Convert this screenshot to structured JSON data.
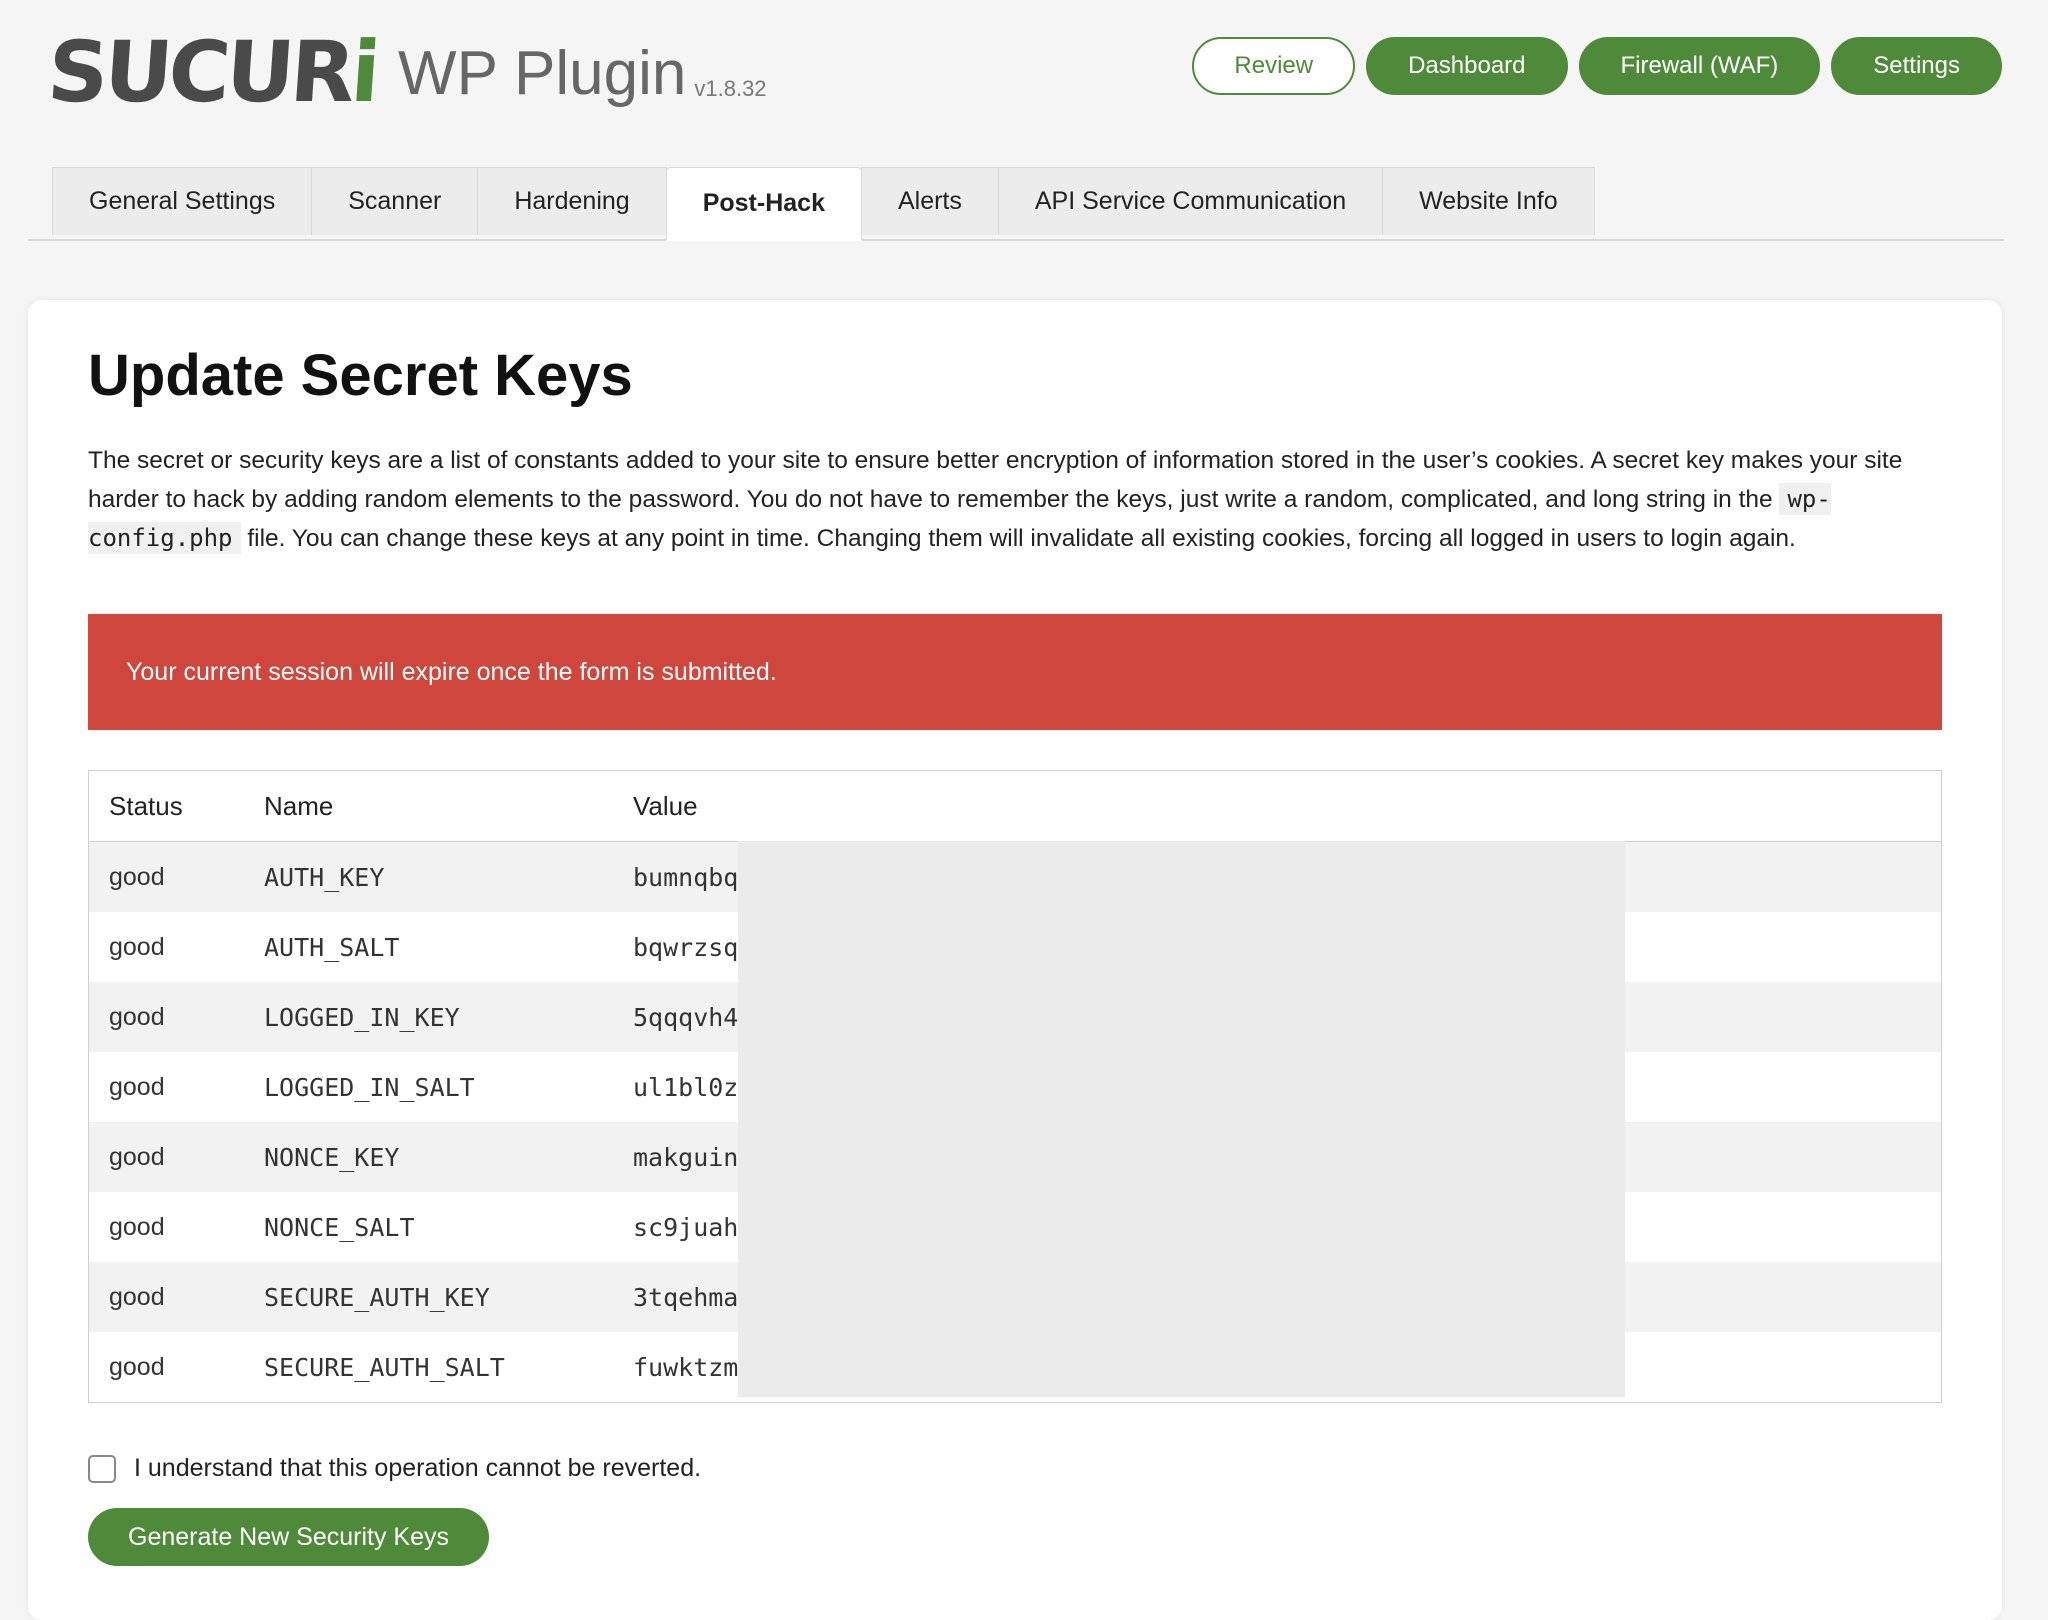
{
  "header": {
    "logo_text": "SUCURi",
    "product": "WP Plugin",
    "version": "v1.8.32",
    "buttons": [
      "Review",
      "Dashboard",
      "Firewall (WAF)",
      "Settings"
    ]
  },
  "tabs": [
    {
      "label": "General Settings",
      "active": false
    },
    {
      "label": "Scanner",
      "active": false
    },
    {
      "label": "Hardening",
      "active": false
    },
    {
      "label": "Post-Hack",
      "active": true
    },
    {
      "label": "Alerts",
      "active": false
    },
    {
      "label": "API Service Communication",
      "active": false
    },
    {
      "label": "Website Info",
      "active": false
    }
  ],
  "main": {
    "title": "Update Secret Keys",
    "desc_part1": "The secret or security keys are a list of constants added to your site to ensure better encryption of information stored in the user’s cookies. A secret key makes your site harder to hack by adding random elements to the password. You do not have to remember the keys, just write a random, complicated, and long string in the",
    "desc_code": "wp-config.php",
    "desc_part2": "file. You can change these keys at any point in time. Changing them will invalidate all existing cookies, forcing all logged in users to login again.",
    "alert": "Your current session will expire once the form is submitted.",
    "table": {
      "headers": [
        "Status",
        "Name",
        "Value"
      ],
      "rows": [
        {
          "status": "good",
          "name": "AUTH_KEY",
          "value": "bumnqbq"
        },
        {
          "status": "good",
          "name": "AUTH_SALT",
          "value": "bqwrzsq"
        },
        {
          "status": "good",
          "name": "LOGGED_IN_KEY",
          "value": "5qqqvh4"
        },
        {
          "status": "good",
          "name": "LOGGED_IN_SALT",
          "value": "ul1bl0z"
        },
        {
          "status": "good",
          "name": "NONCE_KEY",
          "value": "makguin"
        },
        {
          "status": "good",
          "name": "NONCE_SALT",
          "value": "sc9juah"
        },
        {
          "status": "good",
          "name": "SECURE_AUTH_KEY",
          "value": "3tqehma"
        },
        {
          "status": "good",
          "name": "SECURE_AUTH_SALT",
          "value": "fuwktzm"
        }
      ]
    },
    "confirm_label": "I understand that this operation cannot be reverted.",
    "generate_button": "Generate New Security Keys"
  },
  "colors": {
    "brand_green": "#4e8a3a",
    "alert_red": "#cf463c"
  }
}
